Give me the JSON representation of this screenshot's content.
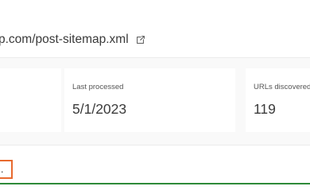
{
  "sitemap": {
    "url_text": "p.com/post-sitemap.xml",
    "external_icon": "external-link-icon"
  },
  "stats": {
    "cards": [
      {
        "label": "",
        "value": ""
      },
      {
        "label": "Last processed",
        "value": "5/1/2023"
      },
      {
        "label": "URLs discovered",
        "value": "119"
      }
    ]
  },
  "status": {
    "text": "l.",
    "highlight_color": "#e86a2f",
    "success_line_color": "#2f8a3a"
  }
}
